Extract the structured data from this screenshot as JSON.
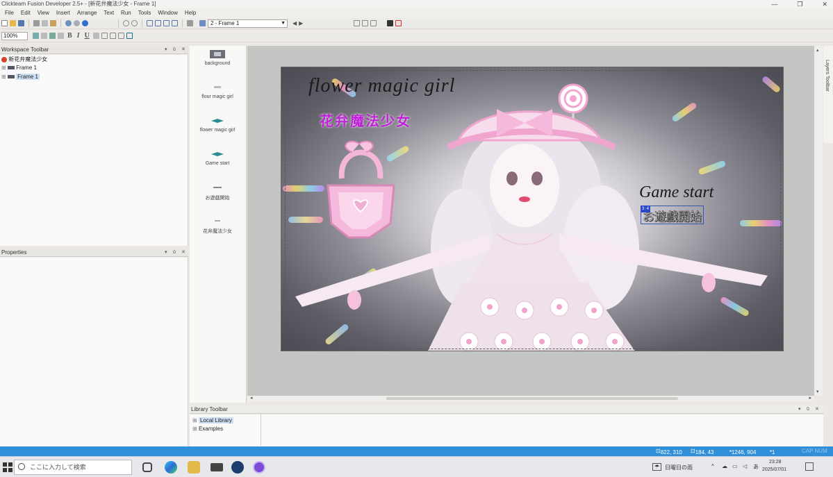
{
  "window": {
    "title": "Clickteam Fusion Developer 2.5+ - [新花弁魔法少女 - Frame 1]",
    "controls": [
      "—",
      "❐",
      "✕"
    ]
  },
  "menu": [
    "File",
    "Edit",
    "View",
    "Insert",
    "Arrange",
    "Text",
    "Run",
    "Tools",
    "Window",
    "Help"
  ],
  "toolbar": {
    "frame_select": "2 - Frame 1",
    "zoom": "100%"
  },
  "workspace": {
    "header": "Workspace Toolbar",
    "tree": [
      {
        "label": "新花弁魔法少女",
        "level": 0,
        "selected": false
      },
      {
        "label": "Frame 1",
        "level": 1,
        "selected": false
      },
      {
        "label": "Frame 1",
        "level": 1,
        "selected": true
      }
    ]
  },
  "properties": {
    "header": "Properties"
  },
  "layers": {
    "label": "Layers Toolbar"
  },
  "objects": [
    {
      "label": "background"
    },
    {
      "label": "flour magic girl"
    },
    {
      "label": "flower magic girl"
    },
    {
      "label": "Game start"
    },
    {
      "label": "お遊戯開始"
    },
    {
      "label": "花弁魔法少女"
    }
  ],
  "canvas": {
    "title_en": "flower magic girl",
    "title_jp": "花弁魔法少女",
    "start_en": "Game start",
    "start_jp": "お遊戯開始",
    "selection_badge": "3: 4"
  },
  "library": {
    "header": "Library Toolbar",
    "items": [
      "Local Library",
      "Examples"
    ]
  },
  "status": {
    "mouse": "822, 310",
    "size": "184, 43",
    "frame_size": "1246, 904",
    "layer": "1",
    "extra": "CAP NUM"
  },
  "taskbar": {
    "search_placeholder": "ここに入力して検索",
    "weather": "日曜日の雨",
    "time": "23:28",
    "date": "2025/07/01",
    "ime": "あ"
  },
  "colors": {
    "status_bar": "#2f8fd8",
    "title_jp": "#c020d8"
  }
}
